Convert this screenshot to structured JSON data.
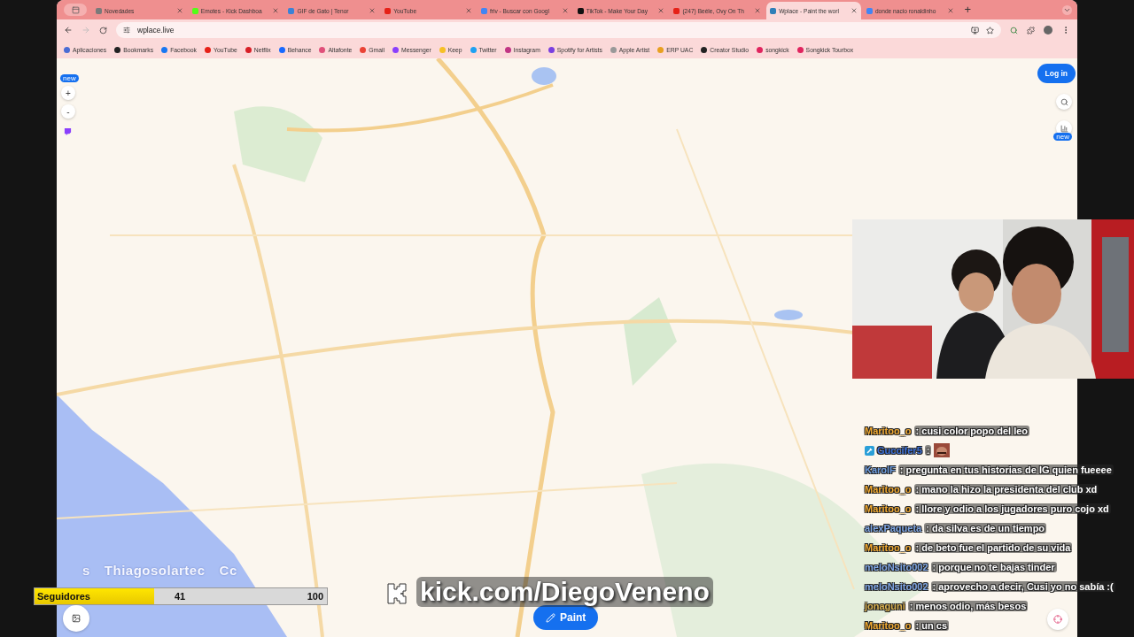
{
  "tabs": [
    {
      "title": "Novedades",
      "selected": false,
      "color": "#7a7a7a"
    },
    {
      "title": "Emotes - Kick Dashboa",
      "selected": false,
      "color": "#53fc18"
    },
    {
      "title": "GIF de Gato | Tenor",
      "selected": false,
      "color": "#3b82d6"
    },
    {
      "title": "YouTube",
      "selected": false,
      "color": "#e62117"
    },
    {
      "title": "friv - Buscar con Googl",
      "selected": false,
      "color": "#4285f4"
    },
    {
      "title": "TikTok - Make Your Day",
      "selected": false,
      "color": "#111111"
    },
    {
      "title": "(247) Beéle, Ovy On Th",
      "selected": false,
      "color": "#e62117"
    },
    {
      "title": "Wplace - Paint the worl",
      "selected": true,
      "color": "#2f7fb8"
    },
    {
      "title": "donde nacio ronaldinho",
      "selected": false,
      "color": "#4285f4"
    }
  ],
  "new_tab": "+",
  "nav": {
    "back_disabled": false,
    "forward_disabled": true
  },
  "address": "wplace.live",
  "bookmarks": [
    {
      "label": "Aplicaciones",
      "color": "#4a6cd4"
    },
    {
      "label": "Bookmarks",
      "color": "#222222"
    },
    {
      "label": "Facebook",
      "color": "#1877f2"
    },
    {
      "label": "YouTube",
      "color": "#e62117"
    },
    {
      "label": "Netflix",
      "color": "#d81f26"
    },
    {
      "label": "Behance",
      "color": "#1769ff"
    },
    {
      "label": "Altafonte",
      "color": "#e0507a"
    },
    {
      "label": "Gmail",
      "color": "#ea4335"
    },
    {
      "label": "Messenger",
      "color": "#8a3ffc"
    },
    {
      "label": "Keep",
      "color": "#f6c026"
    },
    {
      "label": "Twitter",
      "color": "#1da1f2"
    },
    {
      "label": "Instagram",
      "color": "#c13584"
    },
    {
      "label": "Spotify for Artists",
      "color": "#7a3fe0"
    },
    {
      "label": "Apple Artist",
      "color": "#999999"
    },
    {
      "label": "ERP UAC",
      "color": "#e8a020"
    },
    {
      "label": "Creator Studio",
      "color": "#222222"
    },
    {
      "label": "songkick",
      "color": "#e0245e"
    },
    {
      "label": "Songkick Tourbox",
      "color": "#e0245e"
    }
  ],
  "left_toolbar": {
    "badge": "new",
    "zoom_in": "+",
    "zoom_out": "-"
  },
  "right_toolbar": {
    "login": "Log in",
    "badge": "new"
  },
  "paint_button": "Paint",
  "marquee": [
    "s",
    "Thiagosolartec",
    "Cc"
  ],
  "followers": {
    "label": "Seguidores",
    "count": "41",
    "goal": "100",
    "level": 0.41
  },
  "stream_url": "kick.com/DiegoVeneno",
  "chat": [
    {
      "user": "Maritoo_o",
      "color": "#f0a830",
      "kind": "text",
      "text": ": cusi color popo del leo",
      "badge": false
    },
    {
      "user": "Guccifer5",
      "color": "#3a6fd8",
      "kind": "emote",
      "text": ":",
      "badge": true
    },
    {
      "user": "KarolF",
      "color": "#6f9ee0",
      "kind": "text",
      "text": ": pregunta en tus historias de IG quien fueeee",
      "badge": false
    },
    {
      "user": "Maritoo_o",
      "color": "#f0a830",
      "kind": "text",
      "text": ": mano la hizo la presidenta del club xd",
      "badge": false
    },
    {
      "user": "Maritoo_o",
      "color": "#f0a830",
      "kind": "text",
      "text": ": llore y odio a los jugadores puro cojo xd",
      "badge": false
    },
    {
      "user": "alexPaqueta",
      "color": "#7fa7e6",
      "kind": "text",
      "text": ": da silva es de un tiempo",
      "badge": false
    },
    {
      "user": "Maritoo_o",
      "color": "#f0a830",
      "kind": "text",
      "text": ": de beto fue el partido de su vida",
      "badge": false
    },
    {
      "user": "meloNsito002",
      "color": "#7fa7e6",
      "kind": "text",
      "text": ": porque no te bajas tinder",
      "badge": false
    },
    {
      "user": "meloNsito002",
      "color": "#7fa7e6",
      "kind": "text",
      "text": ": aprovecho a decir, Cusi yo no sabía :(",
      "badge": false
    },
    {
      "user": "jonaguni",
      "color": "#d8b050",
      "kind": "text",
      "text": ": menos odio, más besos",
      "badge": false
    },
    {
      "user": "Maritoo_o",
      "color": "#f0a830",
      "kind": "text",
      "text": ": un cs",
      "badge": false
    }
  ]
}
